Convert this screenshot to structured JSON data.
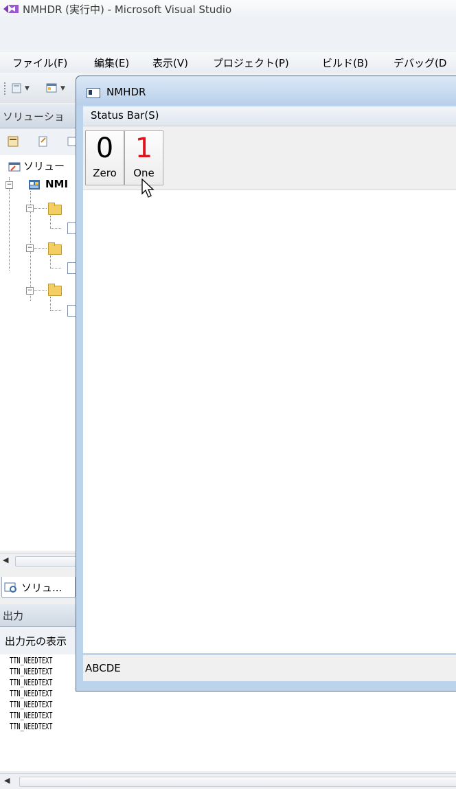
{
  "vs": {
    "title": "NMHDR (実行中) - Microsoft Visual Studio",
    "menu": [
      "ファイル(F)",
      "編集(E)",
      "表示(V)",
      "プロジェクト(P)",
      "ビルド(B)",
      "デバッグ(D"
    ]
  },
  "solution_explorer": {
    "header": "ソリューショ",
    "root_label": "ソリュー",
    "project_label": "NMI",
    "tab_label": "ソリュ..."
  },
  "output": {
    "header": "出力",
    "source_label": "出力元の表示",
    "lines": [
      "TTN_NEEDTEXT",
      "TTN_NEEDTEXT",
      "TTN_NEEDTEXT",
      "TTN_NEEDTEXT",
      "TTN_NEEDTEXT",
      "TTN_NEEDTEXT",
      "TTN_NEEDTEXT"
    ]
  },
  "app": {
    "title": "NMHDR",
    "menu": "Status Bar(S)",
    "buttons": [
      {
        "big": "0",
        "label": "Zero",
        "color": "#000000"
      },
      {
        "big": "1",
        "label": "One",
        "color": "#e0141e"
      }
    ],
    "status_text": "ABCDE"
  },
  "colors": {
    "app_frame": "#bcd3ec",
    "red_digit": "#e0141e"
  }
}
